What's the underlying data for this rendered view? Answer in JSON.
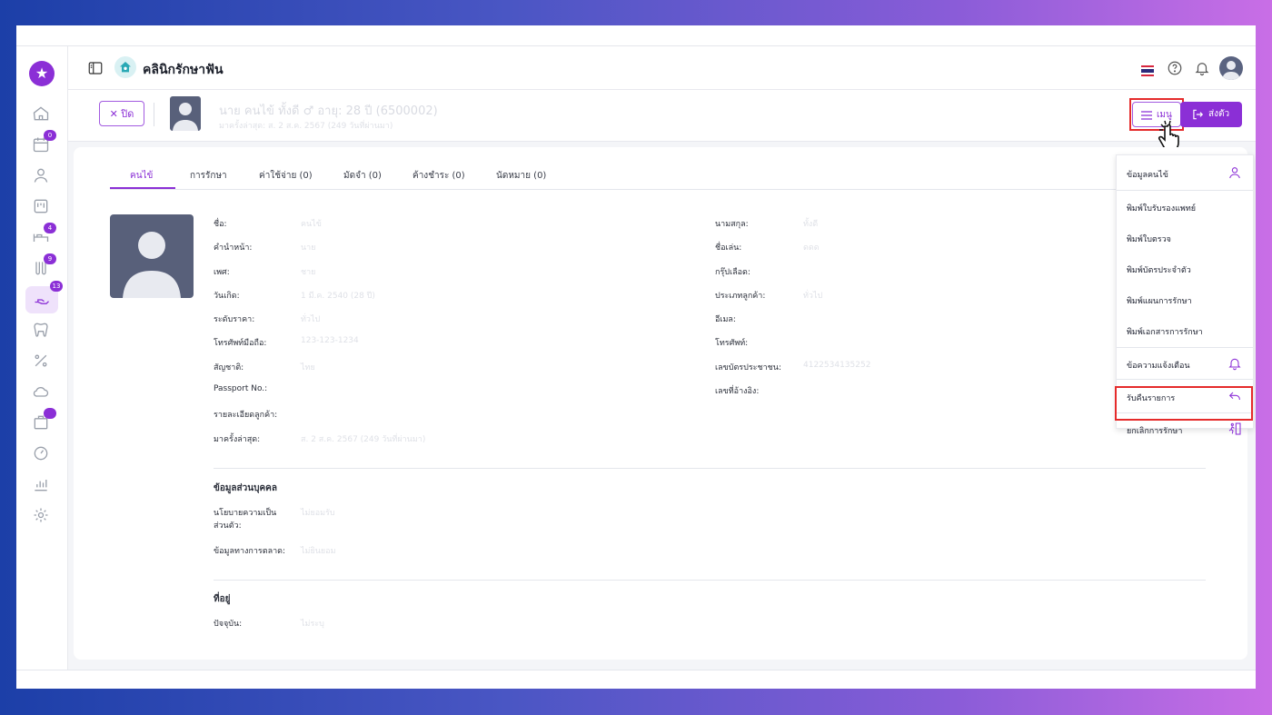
{
  "header": {
    "clinic_name": "คลินิกรักษาฟัน",
    "flag_icon": "thailand-flag-icon",
    "help_icon": "help-circle-icon",
    "bell_icon": "bell-icon"
  },
  "sidebar": {
    "badges": {
      "calendar": "0",
      "bed": "4",
      "lab": "9",
      "treatment": "13"
    }
  },
  "patient_bar": {
    "close_label": "ปิด",
    "name": "นาย คนไข้ ทั้งดี ♂ อายุ: 28 ปี (6500002)",
    "subtitle": "มาครั้งล่าสุด: ส. 2 ส.ค. 2567 (249 วันที่ผ่านมา)",
    "menu_label": "เมนู",
    "checkin_label": "ส่งตัว"
  },
  "tabs": [
    {
      "label": "คนไข้"
    },
    {
      "label": "การรักษา"
    },
    {
      "label": "ค่าใช้จ่าย (0)"
    },
    {
      "label": "มัดจำ (0)"
    },
    {
      "label": "ค้างชำระ (0)"
    },
    {
      "label": "นัดหมาย (0)"
    }
  ],
  "info": {
    "left": [
      {
        "label": "ชื่อ:",
        "value": "คนไข้"
      },
      {
        "label": "คำนำหน้า:",
        "value": "นาย"
      },
      {
        "label": "เพศ:",
        "value": "ชาย"
      },
      {
        "label": "วันเกิด:",
        "value": "1 มี.ค. 2540 (28 ปี)"
      },
      {
        "label": "ระดับราคา:",
        "value": "ทั่วไป"
      },
      {
        "label": "โทรศัพท์มือถือ:",
        "value": "123-123-1234"
      },
      {
        "label": "สัญชาติ:",
        "value": "ไทย"
      },
      {
        "label": "Passport No.:",
        "value": ""
      },
      {
        "label": "รายละเอียดลูกค้า:",
        "value": ""
      },
      {
        "label": "มาครั้งล่าสุด:",
        "value": "ส. 2 ส.ค. 2567 (249 วันที่ผ่านมา)"
      }
    ],
    "right": [
      {
        "label": "นามสกุล:",
        "value": "ทั้งดี"
      },
      {
        "label": "ชื่อเล่น:",
        "value": "ดดด"
      },
      {
        "label": "กรุ๊ปเลือด:",
        "value": ""
      },
      {
        "label": "ประเภทลูกค้า:",
        "value": "ทั่วไป"
      },
      {
        "label": "อีเมล:",
        "value": ""
      },
      {
        "label": "โทรศัพท์:",
        "value": ""
      },
      {
        "label": "เลขบัตรประชาชน:",
        "value": "4122534135252"
      },
      {
        "label": "เลขที่อ้างอิง:",
        "value": ""
      }
    ]
  },
  "personal": {
    "title": "ข้อมูลส่วนบุคคล",
    "privacy_label_1": "นโยบายความเป็น",
    "privacy_label_2": "ส่วนตัว:",
    "privacy_value": "ไม่ยอมรับ",
    "marketing_label": "ข้อมูลทางการตลาด:",
    "marketing_value": "ไม่ยินยอม"
  },
  "address": {
    "title": "ที่อยู่",
    "current_label": "ปัจจุบัน:",
    "current_value": "ไม่ระบุ"
  },
  "dropdown": {
    "items": [
      {
        "label": "ข้อมูลคนไข้",
        "icon": "user-icon"
      },
      {
        "label": "พิมพ์ใบรับรองแพทย์",
        "icon": ""
      },
      {
        "label": "พิมพ์ใบตรวจ",
        "icon": ""
      },
      {
        "label": "พิมพ์บัตรประจำตัว",
        "icon": ""
      },
      {
        "label": "พิมพ์แผนการรักษา",
        "icon": ""
      },
      {
        "label": "พิมพ์เอกสารการรักษา",
        "icon": ""
      },
      {
        "label": "ข้อความแจ้งเตือน",
        "icon": "bell-icon"
      },
      {
        "label": "รับคืนรายการ",
        "icon": "return-arrow-icon"
      },
      {
        "label": "ยกเลิกการรักษา",
        "icon": "exit-runner-icon"
      }
    ]
  },
  "colors": {
    "accent": "#8b2fd6",
    "highlight": "#e52b2b"
  }
}
